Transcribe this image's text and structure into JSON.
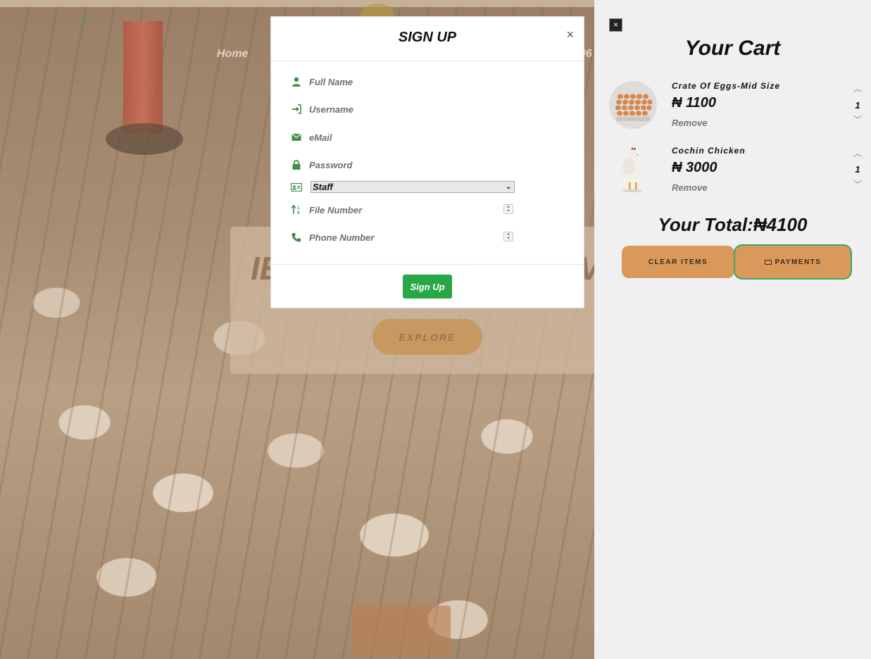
{
  "background": {
    "nav_home": "Home",
    "nav_partial": "06",
    "hero_text_left": "IE",
    "hero_text_right": "V",
    "explore_label": "EXPLORE"
  },
  "modal": {
    "title": "SIGN UP",
    "close_glyph": "×",
    "fields": {
      "full_name": "Full Name",
      "username": "Username",
      "email": "eMail",
      "password": "Password",
      "role_selected": "Staff",
      "file_number": "File Number",
      "phone_number": "Phone Number"
    },
    "submit_label": "Sign Up"
  },
  "cart": {
    "close_glyph": "×",
    "title": "Your Cart",
    "items": [
      {
        "name": "Crate Of Eggs-Mid Size",
        "price": "₦ 1100",
        "remove": "Remove",
        "qty": "1"
      },
      {
        "name": "Cochin Chicken",
        "price": "₦ 3000",
        "remove": "Remove",
        "qty": "1"
      }
    ],
    "total": "Your Total:₦4100",
    "clear_label": "CLEAR ITEMS",
    "payments_label": "PAYMENTS"
  },
  "colors": {
    "accent_green": "#28a745",
    "icon_green": "#3f8f4a",
    "cart_button": "#d9995b"
  }
}
